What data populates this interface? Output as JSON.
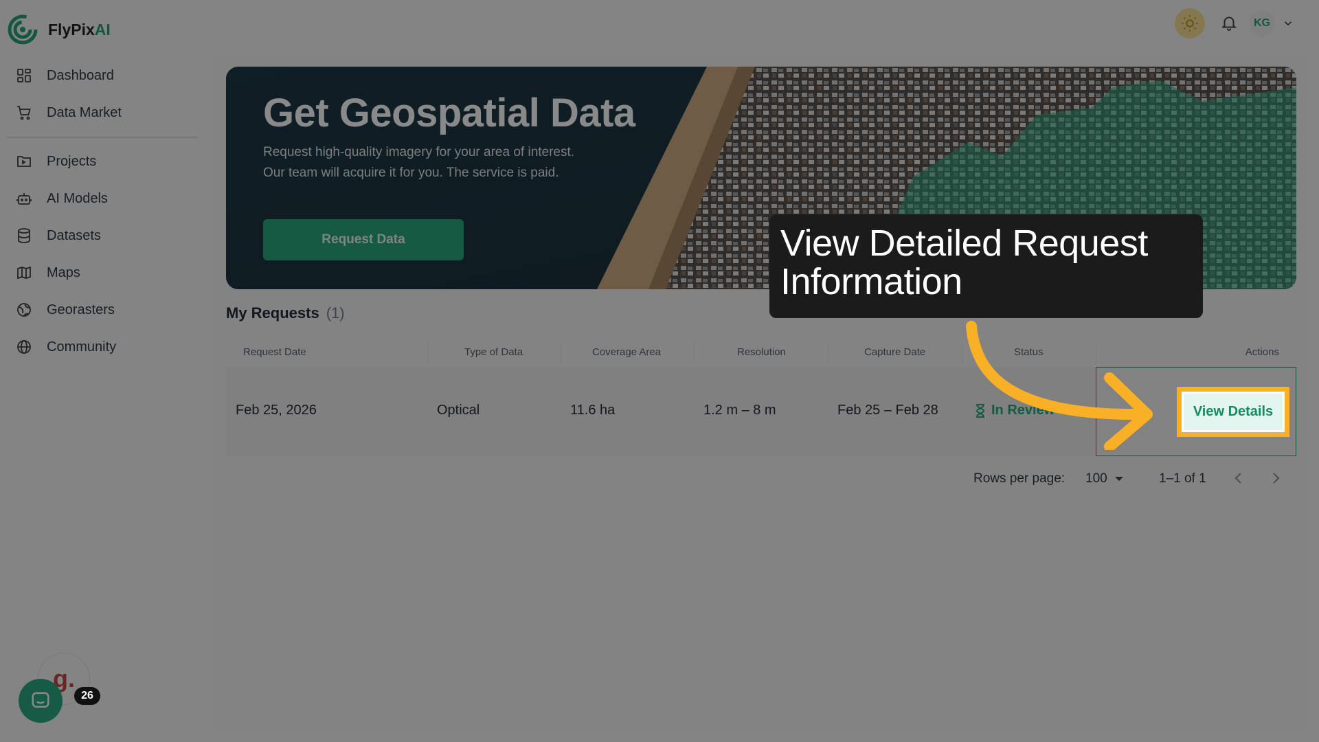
{
  "app": {
    "logo_text_main": "FlyPix",
    "logo_text_accent": "AI",
    "brand_color": "#18a074"
  },
  "sidebar": {
    "items": [
      {
        "label": "Dashboard",
        "icon": "dashboard-icon"
      },
      {
        "label": "Data Market",
        "icon": "cart-icon"
      },
      {
        "label": "Projects",
        "icon": "folder-icon"
      },
      {
        "label": "AI Models",
        "icon": "robot-icon"
      },
      {
        "label": "Datasets",
        "icon": "database-icon"
      },
      {
        "label": "Maps",
        "icon": "map-icon"
      },
      {
        "label": "Georasters",
        "icon": "globe-grid-icon"
      },
      {
        "label": "Community",
        "icon": "globe-icon"
      }
    ]
  },
  "topbar": {
    "user_initials": "KG"
  },
  "banner": {
    "title": "Get Geospatial Data",
    "subtitle_line1": "Request high-quality imagery for your area of interest.",
    "subtitle_line2": "Our team will acquire it for you. The service is paid.",
    "button_label": "Request Data"
  },
  "requests": {
    "title": "My Requests",
    "count": "(1)",
    "columns": [
      "Request Date",
      "Type of Data",
      "Coverage Area",
      "Resolution",
      "Capture Date",
      "Status",
      "Actions"
    ],
    "rows": [
      {
        "request_date": "Feb 25, 2026",
        "type": "Optical",
        "coverage": "11.6 ha",
        "resolution": "1.2 m – 8 m",
        "capture_date": "Feb 25 – Feb 28",
        "status": "In Review",
        "action_label": "View Details"
      }
    ],
    "pagination": {
      "rows_per_page_label": "Rows per page:",
      "rows_per_page_value": "100",
      "range": "1–1 of 1"
    }
  },
  "tooltip": {
    "text": "View Detailed Request Information"
  },
  "widgets": {
    "g_logo": "g.",
    "notification_count": "26"
  }
}
